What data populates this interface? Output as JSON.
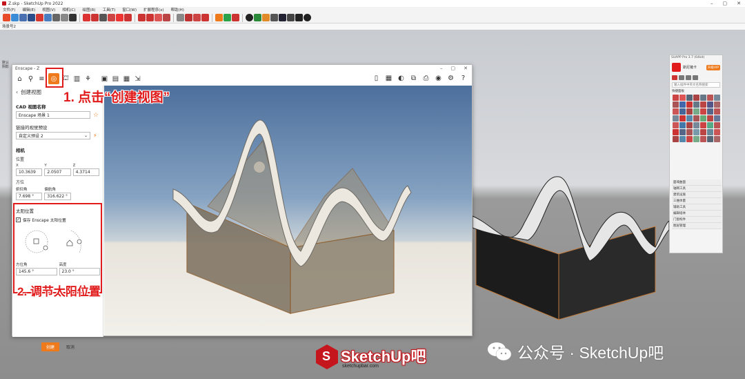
{
  "sketchup": {
    "title": "Z.skp - SketchUp Pro 2022",
    "menu": [
      "文件(F)",
      "编辑(E)",
      "视图(V)",
      "相机(C)",
      "绘图(R)",
      "工具(T)",
      "窗口(W)",
      "扩展程序(x)",
      "帮助(H)"
    ],
    "scene_tab": "场景号2",
    "left_labels": [
      "默认",
      "阴影"
    ]
  },
  "enscape": {
    "title": "Enscape - Z",
    "panel": {
      "header": "创建视图",
      "cad_name_label": "CAD 视图名称",
      "cad_name_value": "Enscape 场景 1",
      "preset_label": "链接的视觉预设",
      "preset_value": "自定义预设 2",
      "camera_label": "相机",
      "position_label": "位置",
      "x_label": "X",
      "x_value": "10.3639",
      "y_label": "Y",
      "y_value": "2.0507",
      "z_label": "Z",
      "z_value": "4.3714",
      "orientation_label": "方位",
      "pitch_label": "俯仰角",
      "pitch_value": "7.698 °",
      "yaw_label": "偏航角",
      "yaw_value": "316.622 °",
      "sun_label": "太阳位置",
      "keep_sun_label": "保存 Enscape 太阳位置",
      "azimuth_label": "方位角",
      "azimuth_value": "145.6 °",
      "altitude_label": "高度",
      "altitude_value": "23.0 °",
      "create_button": "创建",
      "cancel_button": "取消"
    }
  },
  "annotations": {
    "step1": "1. 点击“创建视图”",
    "step2": "2. 调节太阳位置"
  },
  "suapp": {
    "header": "SUAPP Pro 3.7 (64bit)",
    "user": "斯尼猪卡",
    "vip": "升级VIP",
    "search_placeholder": "输入插件中英文名称搜索",
    "section": "快捷面板",
    "categories": [
      "面域曲面",
      "轴网工具",
      "建筑设施",
      "三维体量",
      "辅助工具",
      "编辑墙体",
      "门窗构件",
      "图层管理"
    ]
  },
  "branding": {
    "logo_text": "SketchUp吧",
    "logo_url": "sketchupbar.com",
    "wechat": "公众号 · SketchUp吧"
  },
  "colors": {
    "accent": "#ef7a1c",
    "annotation": "#e11b1b",
    "brand": "#c4161c"
  }
}
